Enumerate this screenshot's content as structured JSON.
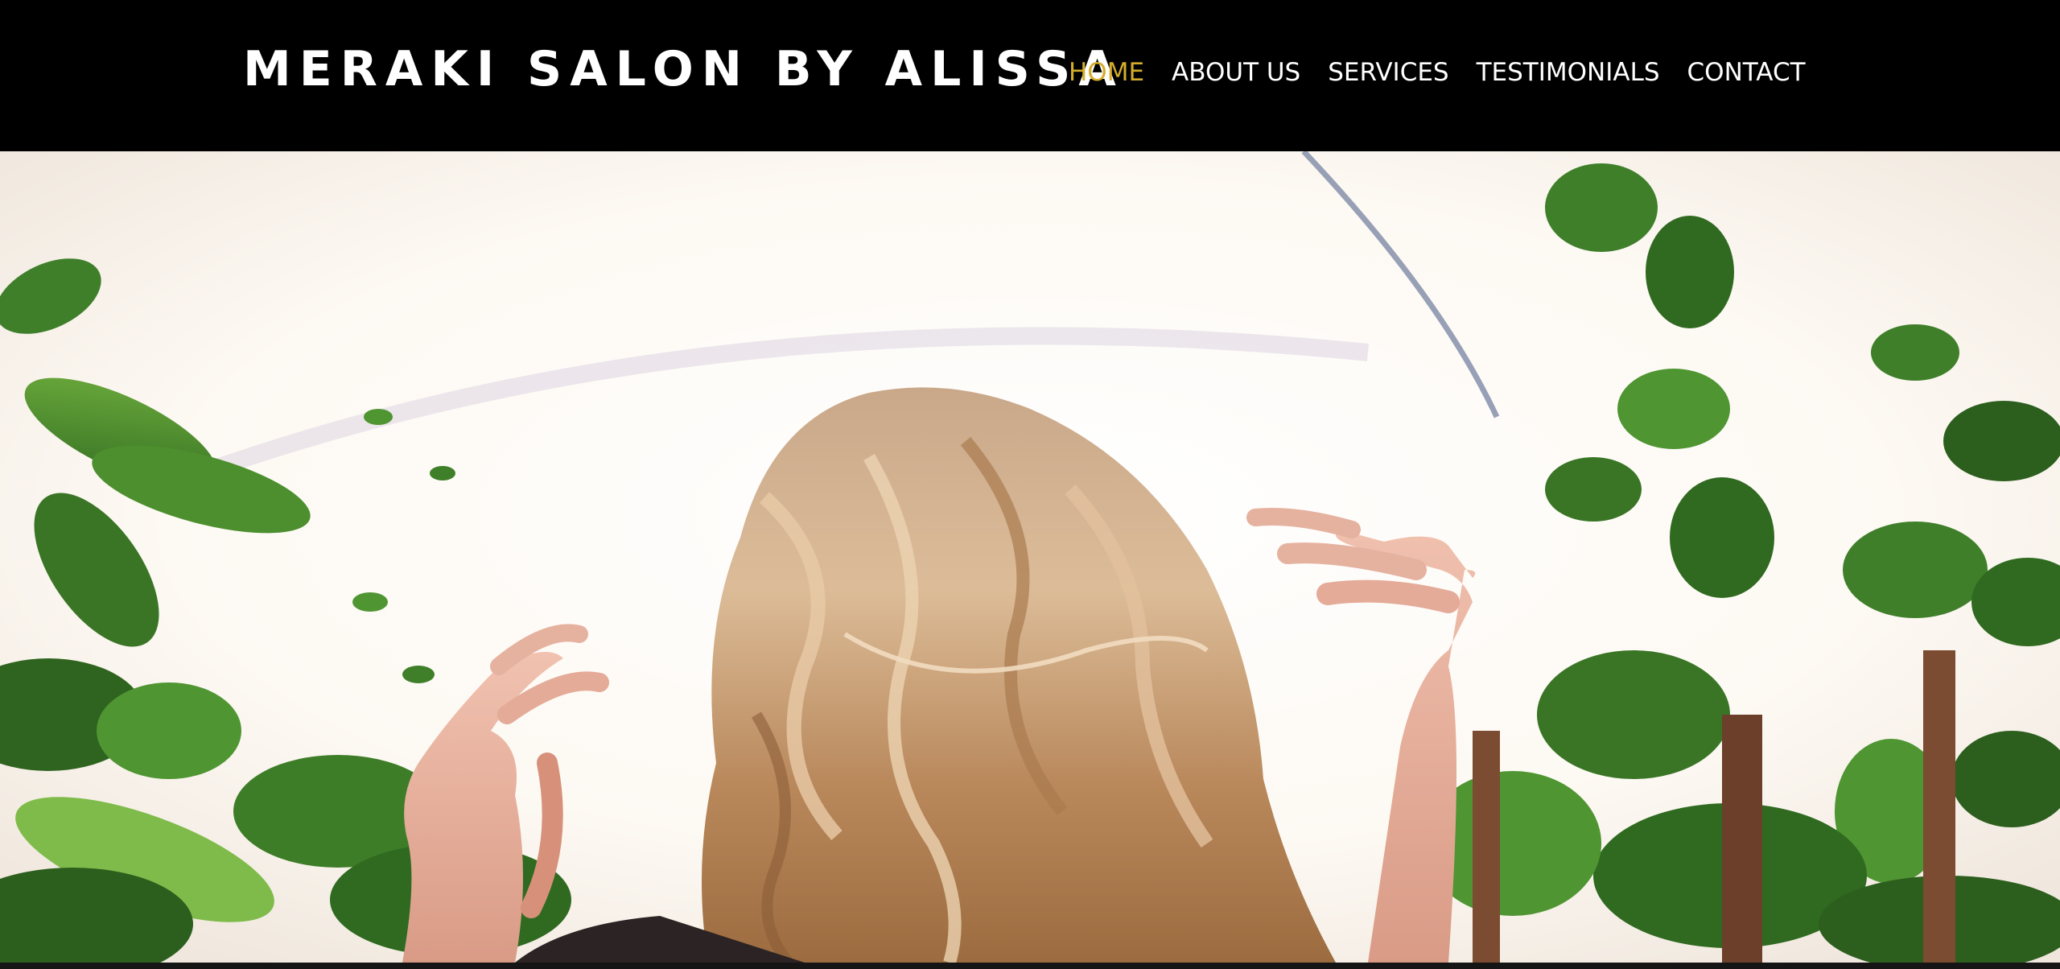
{
  "site": {
    "brand": "MERAKI SALON BY ALISSA"
  },
  "nav": {
    "items": [
      {
        "label": "HOME",
        "active": true
      },
      {
        "label": "ABOUT US",
        "active": false
      },
      {
        "label": "SERVICES",
        "active": false
      },
      {
        "label": "TESTIMONIALS",
        "active": false
      },
      {
        "label": "CONTACT",
        "active": false
      }
    ]
  },
  "colors": {
    "header_bg": "#000000",
    "nav_text": "#ffffff",
    "nav_active": "#d4ad2b"
  },
  "hero": {
    "image": "woman-with-wavy-blonde-hair-among-green-leaves"
  }
}
